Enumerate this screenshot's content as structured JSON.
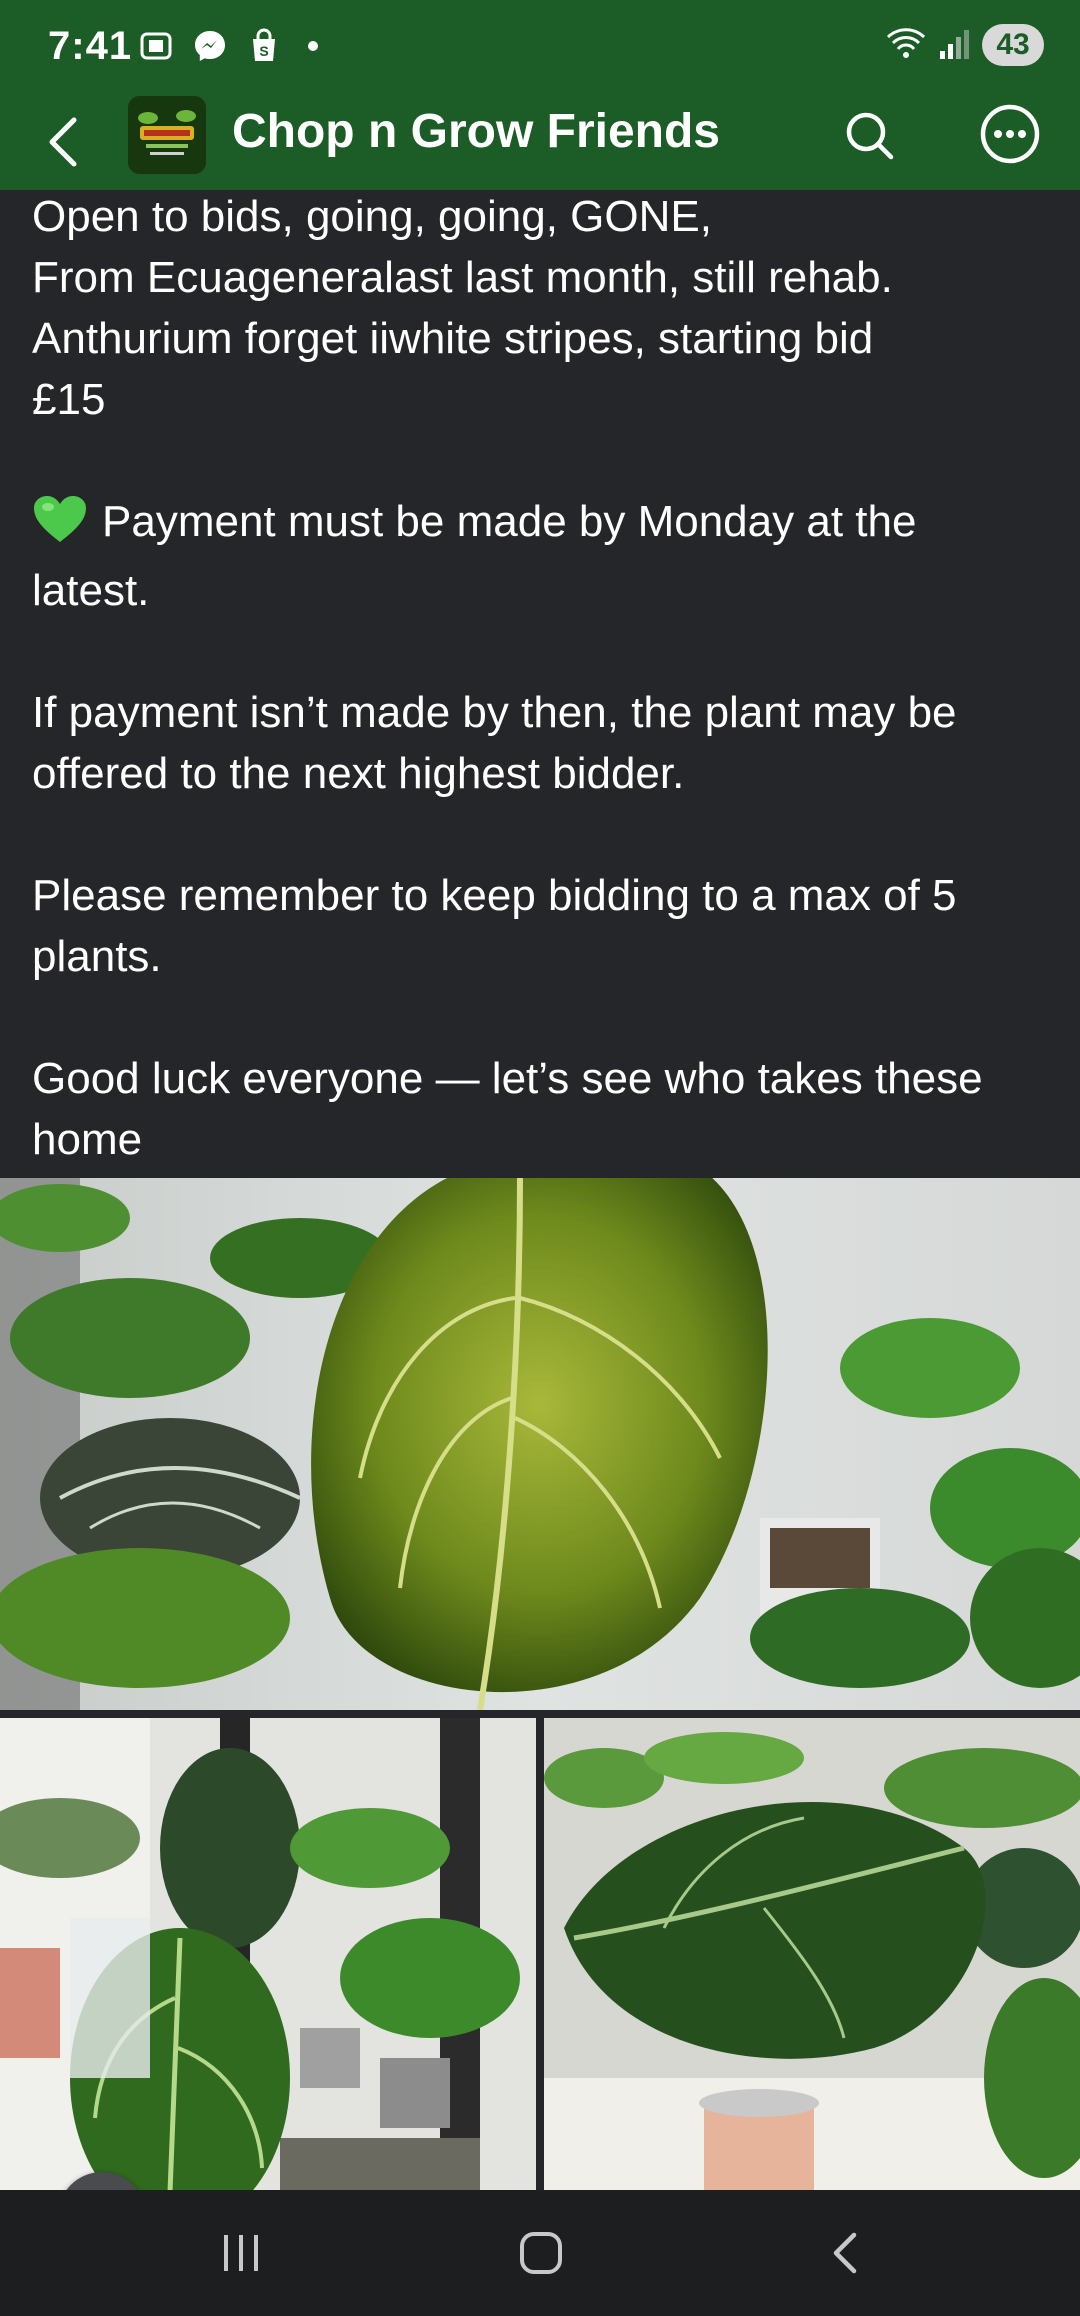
{
  "status_bar": {
    "time": "7:41",
    "battery": "43"
  },
  "header": {
    "title": "Chop n Grow Friends",
    "back_icon": "chevron-left-icon",
    "search_icon": "search-icon",
    "more_icon": "more-horizontal-icon"
  },
  "post": {
    "lines": [
      "Open to bids, going, going, GONE,",
      "From Ecuageneralast last month, still rehab.",
      "Anthurium forget iiwhite stripes, starting bid",
      "£15"
    ],
    "payment_line_1": "Payment must be made by Monday at the",
    "payment_line_2": "latest.",
    "notice_line_1": "If payment isn’t made by then, the plant may be",
    "notice_line_2": "offered to the next highest bidder.",
    "limit_line_1": "Please remember to keep bidding to a max of 5",
    "limit_line_2": "plants.",
    "luck_line_1": "Good luck everyone — let’s see who takes these",
    "luck_line_2": "home"
  },
  "colors": {
    "header_green": "#1c5c26",
    "background": "#252629",
    "text": "#ffffff",
    "heart": "#4cc84a"
  },
  "navbar": {
    "recents_icon": "recents-icon",
    "home_icon": "home-icon",
    "back_icon": "back-icon"
  }
}
